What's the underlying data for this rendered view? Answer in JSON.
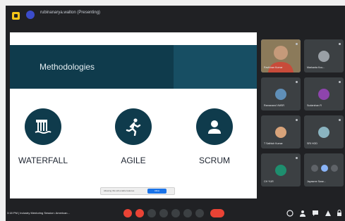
{
  "window": {
    "presenting_title": "rubinanarya.walton (Presenting)"
  },
  "slide": {
    "title": "Methodologies",
    "methods": [
      {
        "label": "WATERFALL",
        "icon": "waterfall-icon"
      },
      {
        "label": "AGILE",
        "icon": "running-person-icon"
      },
      {
        "label": "SCRUM",
        "icon": "person-icon"
      }
    ],
    "consent_text": "Allowing this will enable features",
    "consent_button": "Allow"
  },
  "participants": [
    {
      "name": "Ravikiran Kumar",
      "avatar": "video",
      "color": "#7a6a4f",
      "active": true
    },
    {
      "name": "Markanta Kou...",
      "avatar": "initial",
      "color": "#9aa0a6"
    },
    {
      "name": "Ramanand VMSR",
      "avatar": "initial",
      "color": "#5f8fb8"
    },
    {
      "name": "Sudarshan R",
      "avatar": "initial",
      "color": "#8e44ad"
    },
    {
      "name": "T Sathish Kumar",
      "avatar": "initial",
      "color": "#d8a37a"
    },
    {
      "name": "SRI HOD",
      "avatar": "initial",
      "color": "#8ab4c0"
    },
    {
      "name": "CH YUR",
      "avatar": "initial",
      "color": "#1e8e6e"
    },
    {
      "name": "Jayasree Swar...",
      "avatar": "initial",
      "color": "#5f6368"
    }
  ],
  "bottombar": {
    "meeting_info": "3:18 PM | Industry Mentoring Session: American...",
    "colors": {
      "red": "#ea4335",
      "active_border": "#8ab4f8",
      "slide_dark": "#0f3b4c"
    }
  }
}
